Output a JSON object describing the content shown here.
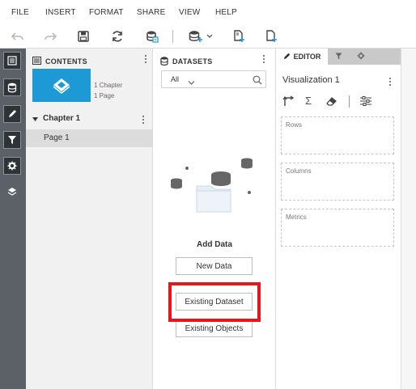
{
  "menu": [
    "FILE",
    "INSERT",
    "FORMAT",
    "SHARE",
    "VIEW",
    "HELP"
  ],
  "toolbar": {
    "icons": [
      "undo-icon",
      "redo-icon",
      "save-icon",
      "refresh-icon",
      "data-source-icon",
      "add-data-icon",
      "chevron-down-icon",
      "new-page-icon",
      "new-chapter-icon"
    ]
  },
  "sidebar": {
    "icons": [
      "table-of-contents-icon",
      "datasets-icon",
      "editor-icon",
      "filter-icon",
      "format-icon",
      "layers-icon"
    ]
  },
  "contents": {
    "title": "CONTENTS",
    "doc_meta_chapters": "1 Chapter",
    "doc_meta_pages": "1 Page",
    "chapter_label": "Chapter 1",
    "page_label": "Page 1"
  },
  "datasets": {
    "title": "DATASETS",
    "filter_value": "All",
    "add_data_label": "Add Data",
    "new_data_label": "New Data",
    "existing_dataset_label": "Existing Dataset",
    "existing_objects_label": "Existing Objects"
  },
  "editor": {
    "tab_label": "EDITOR",
    "visualization_title": "Visualization 1",
    "zones": {
      "rows": "Rows",
      "columns": "Columns",
      "metrics": "Metrics"
    }
  },
  "colors": {
    "highlight": "#e8151c",
    "accent": "#1d9ad6",
    "sidebar": "#5b6166"
  }
}
